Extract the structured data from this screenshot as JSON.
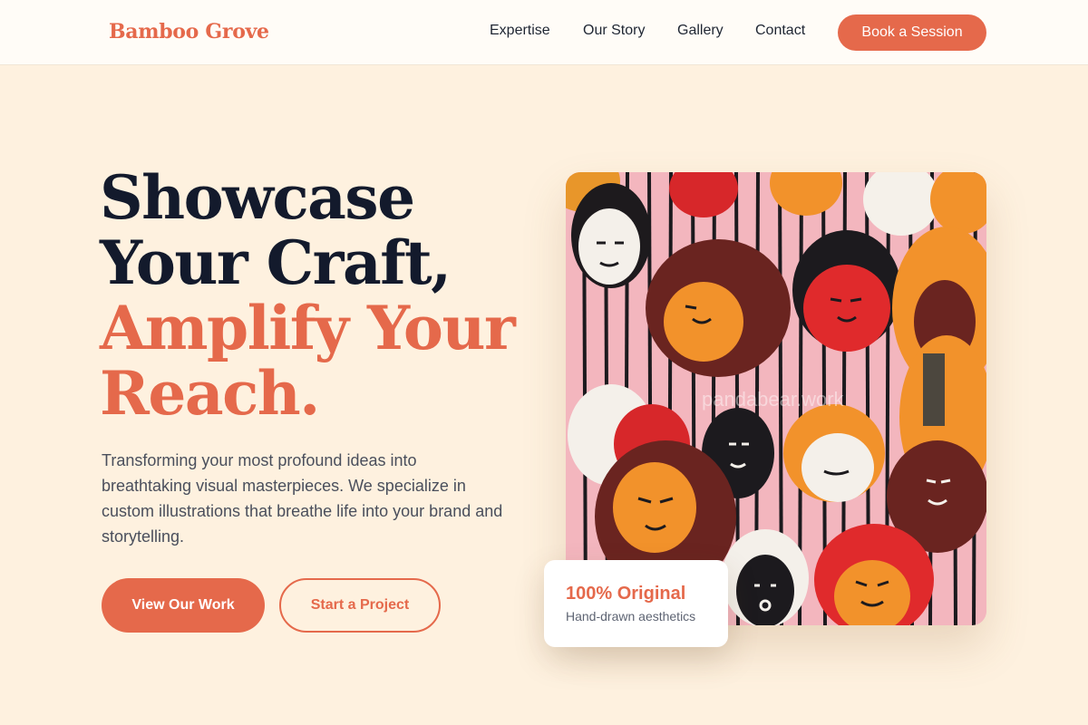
{
  "header": {
    "logo": "Bamboo Grove",
    "nav": [
      "Expertise",
      "Our Story",
      "Gallery",
      "Contact"
    ],
    "cta_label": "Book a Session"
  },
  "hero": {
    "headline_lines": [
      "Showcase",
      "Your Craft,",
      "Amplify Your",
      "Reach."
    ],
    "description": "Transforming your most profound ideas into breathtaking visual masterpieces. We specialize in custom illustrations that breathe life into your brand and storytelling.",
    "primary_cta": "View Our Work",
    "secondary_cta": "Start a Project",
    "image_alt": "Colorful illustrated crowd of faces mural",
    "watermark": "pandabear.work"
  },
  "badge": {
    "title": "100% Original",
    "subtitle": "Hand-drawn aesthetics"
  },
  "colors": {
    "accent": "#e5694b",
    "heading": "#131a2c",
    "background": "#fef1df",
    "header_bg": "#fffcf7"
  }
}
